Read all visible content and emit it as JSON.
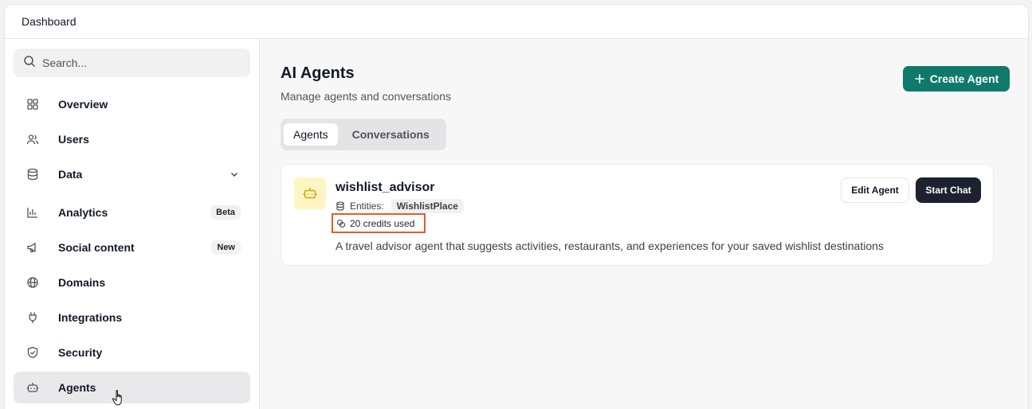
{
  "topbar": {
    "title": "Dashboard"
  },
  "sidebar": {
    "search_placeholder": "Search...",
    "items": [
      {
        "label": "Overview",
        "icon": "grid-icon"
      },
      {
        "label": "Users",
        "icon": "users-icon"
      },
      {
        "label": "Data",
        "icon": "database-icon"
      },
      {
        "label": "Analytics",
        "icon": "bar-chart-icon",
        "badge": "Beta"
      },
      {
        "label": "Social content",
        "icon": "megaphone-icon",
        "badge": "New"
      },
      {
        "label": "Domains",
        "icon": "globe-icon"
      },
      {
        "label": "Integrations",
        "icon": "plug-icon"
      },
      {
        "label": "Security",
        "icon": "shield-icon"
      },
      {
        "label": "Agents",
        "icon": "bot-icon",
        "active": true
      }
    ]
  },
  "main": {
    "title": "AI Agents",
    "subtitle": "Manage agents and conversations",
    "create_label": "Create Agent",
    "tabs": [
      {
        "label": "Agents",
        "active": true
      },
      {
        "label": "Conversations"
      }
    ],
    "agent": {
      "name": "wishlist_advisor",
      "entities_label": "Entities:",
      "entity": "WishlistPlace",
      "credits": "20 credits used",
      "description": "A travel advisor agent that suggests activities, restaurants, and experiences for your saved wishlist destinations",
      "edit_label": "Edit Agent",
      "chat_label": "Start Chat"
    }
  },
  "colors": {
    "accent": "#0f7a6b",
    "highlight": "#e35d2a",
    "dark_button": "#1c2230"
  }
}
